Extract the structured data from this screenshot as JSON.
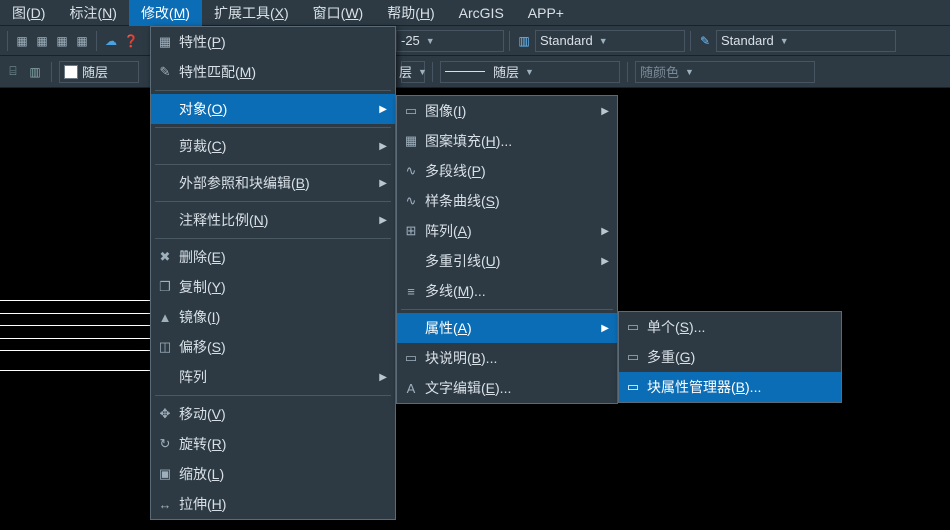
{
  "menubar": {
    "items": [
      {
        "label_html": "图(<span class='u'>D</span>)"
      },
      {
        "label_html": "标注(<span class='u'>N</span>)"
      },
      {
        "label_html": "修改(<span class='u'>M</span>)",
        "active": true
      },
      {
        "label_html": "扩展工具(<span class='u'>X</span>)"
      },
      {
        "label_html": "窗口(<span class='u'>W</span>)"
      },
      {
        "label_html": "帮助(<span class='u'>H</span>)"
      },
      {
        "label_html": "ArcGIS"
      },
      {
        "label_html": "APP+"
      }
    ]
  },
  "toolbar": {
    "drop1": "-25",
    "std1": "Standard",
    "std2": "Standard",
    "layer_label": "随层",
    "bylayer2": "随层",
    "bycolor": "随颜色"
  },
  "dd1": {
    "items": [
      {
        "label_html": "特性(<span class='u'>P</span>)",
        "icon": "▦"
      },
      {
        "label_html": "特性匹配(<span class='u'>M</span>)",
        "icon": "✎"
      },
      {
        "sep": true
      },
      {
        "label_html": "对象(<span class='u'>O</span>)",
        "arrow": true,
        "hl": true
      },
      {
        "sep": true
      },
      {
        "label_html": "剪裁(<span class='u'>C</span>)",
        "arrow": true
      },
      {
        "sep": true
      },
      {
        "label_html": "外部参照和块编辑(<span class='u'>B</span>)",
        "arrow": true
      },
      {
        "sep": true
      },
      {
        "label_html": "注释性比例(<span class='u'>N</span>)",
        "arrow": true
      },
      {
        "sep": true
      },
      {
        "label_html": "删除(<span class='u'>E</span>)",
        "icon": "✖"
      },
      {
        "label_html": "复制(<span class='u'>Y</span>)",
        "icon": "❐"
      },
      {
        "label_html": "镜像(<span class='u'>I</span>)",
        "icon": "▲"
      },
      {
        "label_html": "偏移(<span class='u'>S</span>)",
        "icon": "◫"
      },
      {
        "label_html": "阵列",
        "arrow": true
      },
      {
        "sep": true
      },
      {
        "label_html": "移动(<span class='u'>V</span>)",
        "icon": "✥"
      },
      {
        "label_html": "旋转(<span class='u'>R</span>)",
        "icon": "↻"
      },
      {
        "label_html": "缩放(<span class='u'>L</span>)",
        "icon": "▣"
      },
      {
        "label_html": "拉伸(<span class='u'>H</span>)",
        "icon": "↔"
      }
    ]
  },
  "dd2": {
    "items": [
      {
        "label_html": "图像(<span class='u'>I</span>)",
        "icon": "▭",
        "arrow": true
      },
      {
        "label_html": "图案填充(<span class='u'>H</span>)...",
        "icon": "▦"
      },
      {
        "label_html": "多段线(<span class='u'>P</span>)",
        "icon": "∿"
      },
      {
        "label_html": "样条曲线(<span class='u'>S</span>)",
        "icon": "∿"
      },
      {
        "label_html": "阵列(<span class='u'>A</span>)",
        "icon": "⊞",
        "arrow": true
      },
      {
        "label_html": "多重引线(<span class='u'>U</span>)",
        "arrow": true
      },
      {
        "label_html": "多线(<span class='u'>M</span>)...",
        "icon": "≡"
      },
      {
        "sep": true
      },
      {
        "label_html": "属性(<span class='u'>A</span>)",
        "arrow": true,
        "hl": true
      },
      {
        "label_html": "块说明(<span class='u'>B</span>)...",
        "icon": "▭"
      },
      {
        "label_html": "文字编辑(<span class='u'>E</span>)...",
        "icon": "A"
      }
    ]
  },
  "dd3": {
    "items": [
      {
        "label_html": "单个(<span class='u'>S</span>)...",
        "icon": "▭"
      },
      {
        "label_html": "多重(<span class='u'>G</span>)",
        "icon": "▭"
      },
      {
        "label_html": "块属性管理器(<span class='u'>B</span>)...",
        "icon": "▭",
        "hl": true
      }
    ]
  }
}
